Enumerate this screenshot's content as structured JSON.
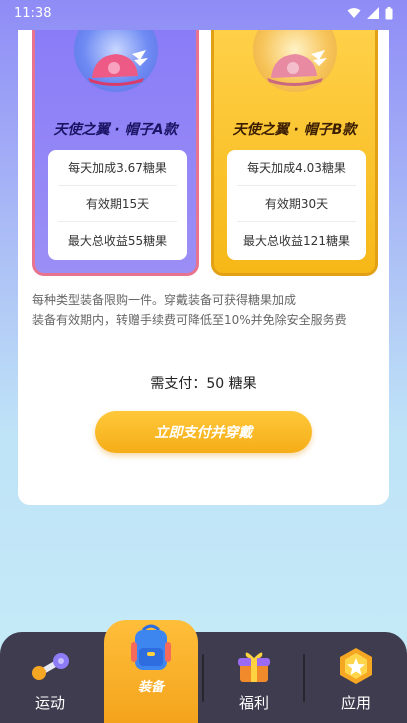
{
  "status_bar": {
    "time": "11:38"
  },
  "products": [
    {
      "title": "天使之翼 · 帽子A款",
      "bonus": "每天加成3.67糖果",
      "validity": "有效期15天",
      "max_income": "最大总收益55糖果"
    },
    {
      "title": "天使之翼 · 帽子B款",
      "bonus": "每天加成4.03糖果",
      "validity": "有效期30天",
      "max_income": "最大总收益121糖果"
    }
  ],
  "notes": {
    "line1": "每种类型装备限购一件。穿戴装备可获得糖果加成",
    "line2": "装备有效期内，转赠手续费可降低至10%并免除安全服务费"
  },
  "payment": {
    "text": "需支付：50 糖果"
  },
  "pay_button": {
    "label": "立即支付并穿戴"
  },
  "tabs": [
    {
      "label": "运动",
      "icon": "dumbbell-icon"
    },
    {
      "label": "装备",
      "icon": "backpack-icon"
    },
    {
      "label": "福利",
      "icon": "gift-icon"
    },
    {
      "label": "应用",
      "icon": "star-badge-icon"
    }
  ],
  "colors": {
    "accent": "#f5ad18",
    "product_a_bg": "#8a7cf7",
    "product_b_bg": "#f6b817",
    "tab_bar": "#3e3c4e"
  }
}
